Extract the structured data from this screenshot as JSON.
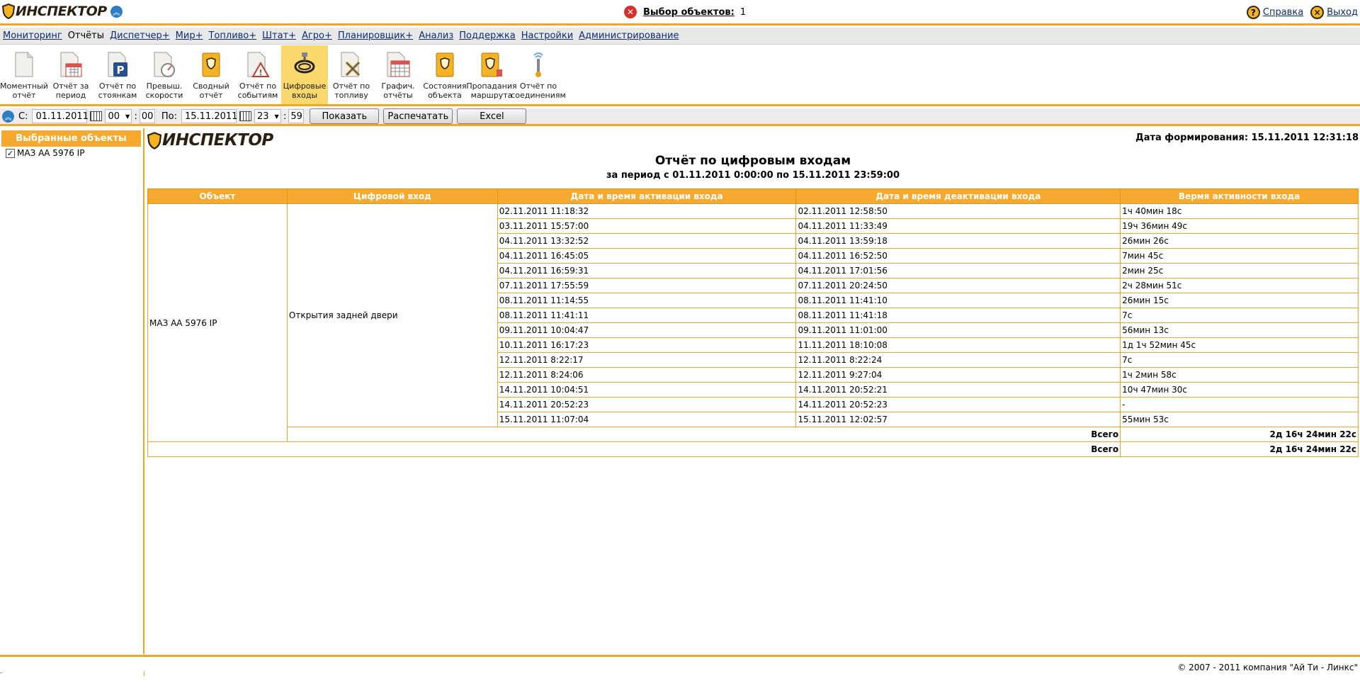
{
  "app": {
    "logo_text": "ИНСПЕКТОР"
  },
  "selection": {
    "label": "Выбор объектов:",
    "count": "1"
  },
  "top_links": {
    "help": "Справка",
    "logout": "Выход"
  },
  "menu": [
    {
      "label": "Мониторинг"
    },
    {
      "label": "Отчёты"
    },
    {
      "label": "Диспетчер+"
    },
    {
      "label": "Мир+"
    },
    {
      "label": "Топливо+"
    },
    {
      "label": "Штат+"
    },
    {
      "label": "Агро+"
    },
    {
      "label": "Планировщик+"
    },
    {
      "label": "Анализ"
    },
    {
      "label": "Поддержка"
    },
    {
      "label": "Настройки"
    },
    {
      "label": "Администрирование"
    }
  ],
  "toolbar": [
    {
      "label": "Моментный\nотчёт",
      "icon": "document-icon"
    },
    {
      "label": "Отчёт за\nпериод",
      "icon": "calendar-doc-icon"
    },
    {
      "label": "Отчёт по\nстоянкам",
      "icon": "parking-icon"
    },
    {
      "label": "Превыш.\nскорости",
      "icon": "speedometer-icon"
    },
    {
      "label": "Сводный\nотчёт",
      "icon": "summary-folder-icon"
    },
    {
      "label": "Отчёт по\nсобытиям",
      "icon": "warning-doc-icon"
    },
    {
      "label": "Цифровые\nвходы",
      "icon": "cable-icon"
    },
    {
      "label": "Отчёт по\nтопливу",
      "icon": "fuel-doc-icon"
    },
    {
      "label": "Графич.\nотчёты",
      "icon": "grid-chart-icon"
    },
    {
      "label": "Состояния\nобъекта",
      "icon": "state-folder-icon"
    },
    {
      "label": "Пропадания\nмаршрута",
      "icon": "route-loss-icon"
    },
    {
      "label": "Отчёт по\nсоединениям",
      "icon": "antenna-icon"
    }
  ],
  "period": {
    "from_label": "С:",
    "from_date": "01.11.2011",
    "from_hour": "00",
    "from_min": "00",
    "to_label": "По:",
    "to_date": "15.11.2011",
    "to_hour": "23",
    "to_min": "59",
    "colon": ":",
    "show_btn": "Показать",
    "print_btn": "Распечатать",
    "excel_btn": "Excel"
  },
  "left_panel": {
    "header": "Выбранные объекты",
    "items": [
      {
        "label": "МАЗ АА 5976 IP",
        "checked": "✓"
      }
    ]
  },
  "report": {
    "logo_text": "ИНСПЕКТОР",
    "generated": "Дата формирования: 15.11.2011 12:31:18",
    "title": "Отчёт по цифровым входам",
    "subtitle": "за период с 01.11.2011 0:00:00 по 15.11.2011 23:59:00",
    "columns": [
      "Объект",
      "Цифровой вход",
      "Дата и время активации входа",
      "Дата и время деактивации входа",
      "Вермя активности входа"
    ],
    "object": "МАЗ АА 5976 IP",
    "input": "Открытия задней двери",
    "rows": [
      [
        "02.11.2011 11:18:32",
        "02.11.2011 12:58:50",
        "1ч 40мин 18с"
      ],
      [
        "03.11.2011 15:57:00",
        "04.11.2011 11:33:49",
        "19ч 36мин 49с"
      ],
      [
        "04.11.2011 13:32:52",
        "04.11.2011 13:59:18",
        "26мин 26с"
      ],
      [
        "04.11.2011 16:45:05",
        "04.11.2011 16:52:50",
        "7мин 45с"
      ],
      [
        "04.11.2011 16:59:31",
        "04.11.2011 17:01:56",
        "2мин 25с"
      ],
      [
        "07.11.2011 17:55:59",
        "07.11.2011 20:24:50",
        "2ч 28мин 51с"
      ],
      [
        "08.11.2011 11:14:55",
        "08.11.2011 11:41:10",
        "26мин 15с"
      ],
      [
        "08.11.2011 11:41:11",
        "08.11.2011 11:41:18",
        "7с"
      ],
      [
        "09.11.2011 10:04:47",
        "09.11.2011 11:01:00",
        "56мин 13с"
      ],
      [
        "10.11.2011 16:17:23",
        "11.11.2011 18:10:08",
        "1д 1ч 52мин 45с"
      ],
      [
        "12.11.2011 8:22:17",
        "12.11.2011 8:22:24",
        "7с"
      ],
      [
        "12.11.2011 8:24:06",
        "12.11.2011 9:27:04",
        "1ч 2мин 58с"
      ],
      [
        "14.11.2011 10:04:51",
        "14.11.2011 20:52:21",
        "10ч 47мин 30с"
      ],
      [
        "14.11.2011 20:52:23",
        "14.11.2011 20:52:23",
        "-"
      ],
      [
        "15.11.2011 11:07:04",
        "15.11.2011 12:02:57",
        "55мин 53с"
      ]
    ],
    "subtotal_label": "Всего",
    "subtotal_value": "2д 16ч 24мин 22с",
    "total_label": "Всего",
    "total_value": "2д 16ч 24мин 22с"
  },
  "footer": {
    "copyright": "© 2007 - 2011 компания \"Ай Ти - Линкс\""
  },
  "colors": {
    "accent": "#f3a424",
    "header_bg": "#f5a92f",
    "link": "#0d2d72"
  }
}
